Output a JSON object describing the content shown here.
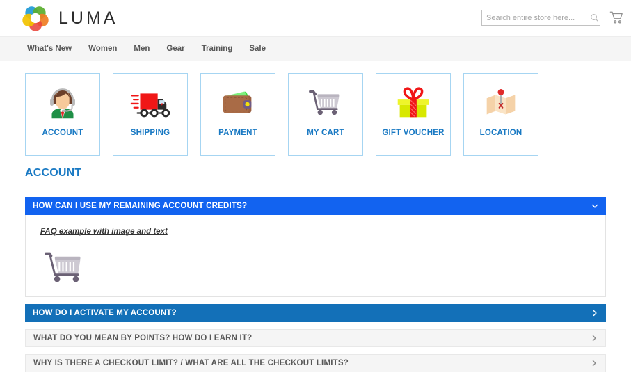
{
  "header": {
    "brand": "LUMA",
    "logo_icon": "luma-ring-logo",
    "search": {
      "placeholder": "Search entire store here...",
      "value": "",
      "icon": "search-icon"
    },
    "cart_icon": "shopping-cart-icon"
  },
  "nav": {
    "items": [
      {
        "label": "What's New"
      },
      {
        "label": "Women"
      },
      {
        "label": "Men"
      },
      {
        "label": "Gear"
      },
      {
        "label": "Training"
      },
      {
        "label": "Sale"
      }
    ]
  },
  "tiles": [
    {
      "label": "ACCOUNT",
      "icon": "support-agent-icon"
    },
    {
      "label": "SHIPPING",
      "icon": "delivery-truck-icon"
    },
    {
      "label": "PAYMENT",
      "icon": "wallet-icon"
    },
    {
      "label": "MY CART",
      "icon": "shopping-cart-icon"
    },
    {
      "label": "GIFT VOUCHER",
      "icon": "gift-box-icon"
    },
    {
      "label": "LOCATION",
      "icon": "map-pin-icon"
    }
  ],
  "section": {
    "title": "ACCOUNT"
  },
  "faq": {
    "items": [
      {
        "question": "HOW CAN I USE MY REMAINING ACCOUNT CREDITS?",
        "state": "open",
        "chevron": "chevron-down-icon",
        "body": {
          "link_text": "FAQ example with image and text",
          "image_icon": "shopping-cart-illustration"
        }
      },
      {
        "question": "HOW DO I ACTIVATE MY ACCOUNT?",
        "state": "active",
        "chevron": "chevron-right-icon"
      },
      {
        "question": "WHAT DO YOU MEAN BY POINTS? HOW DO I EARN IT?",
        "state": "idle",
        "chevron": "chevron-right-icon"
      },
      {
        "question": "WHY IS THERE A CHECKOUT LIMIT? / WHAT ARE ALL THE CHECKOUT LIMITS?",
        "state": "idle",
        "chevron": "chevron-right-icon"
      }
    ]
  },
  "colors": {
    "brand_blue": "#1979c3",
    "accordion_open": "#1263f0",
    "accordion_active": "#1370b8",
    "accordion_idle": "#f5f5f5",
    "nav_bg": "#f5f5f5",
    "text": "#333333"
  }
}
